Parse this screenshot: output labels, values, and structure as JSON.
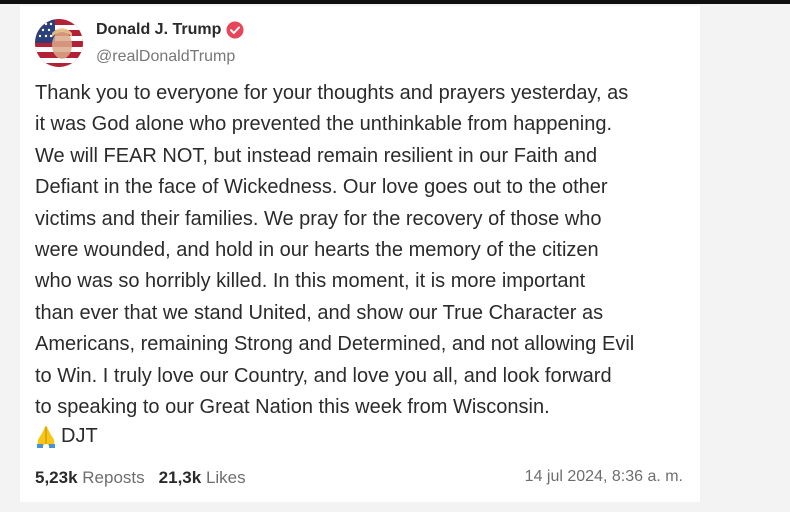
{
  "author": {
    "display_name": "Donald J. Trump",
    "handle": "@realDonaldTrump",
    "avatar_icon": "flag-portrait-avatar",
    "verified_icon": "verified-badge-icon",
    "verified_color": "#e8445a"
  },
  "post": {
    "body": "Thank you to everyone for your thoughts and prayers yesterday, as\nit was God alone who prevented the unthinkable from happening.\nWe will FEAR NOT, but instead remain resilient in our Faith and\nDefiant in the face of Wickedness. Our love goes out to the other\nvictims and their families. We pray for the recovery of those who\nwere wounded, and hold in our hearts the memory of the citizen\nwho was so horribly killed. In this moment, it is more important\nthan ever that we stand United, and show our True Character as\nAmericans, remaining Strong and Determined, and not allowing Evil\nto Win. I truly love our Country, and love you all, and look forward\nto speaking to our Great Nation this week from Wisconsin.",
    "signature_icon": "praying-hands-icon",
    "signature": "DJT"
  },
  "stats": {
    "reposts_count": "5,23k",
    "reposts_label": "Reposts",
    "likes_count": "21,3k",
    "likes_label": "Likes"
  },
  "timestamp": "14 jul 2024, 8:36 a. m."
}
